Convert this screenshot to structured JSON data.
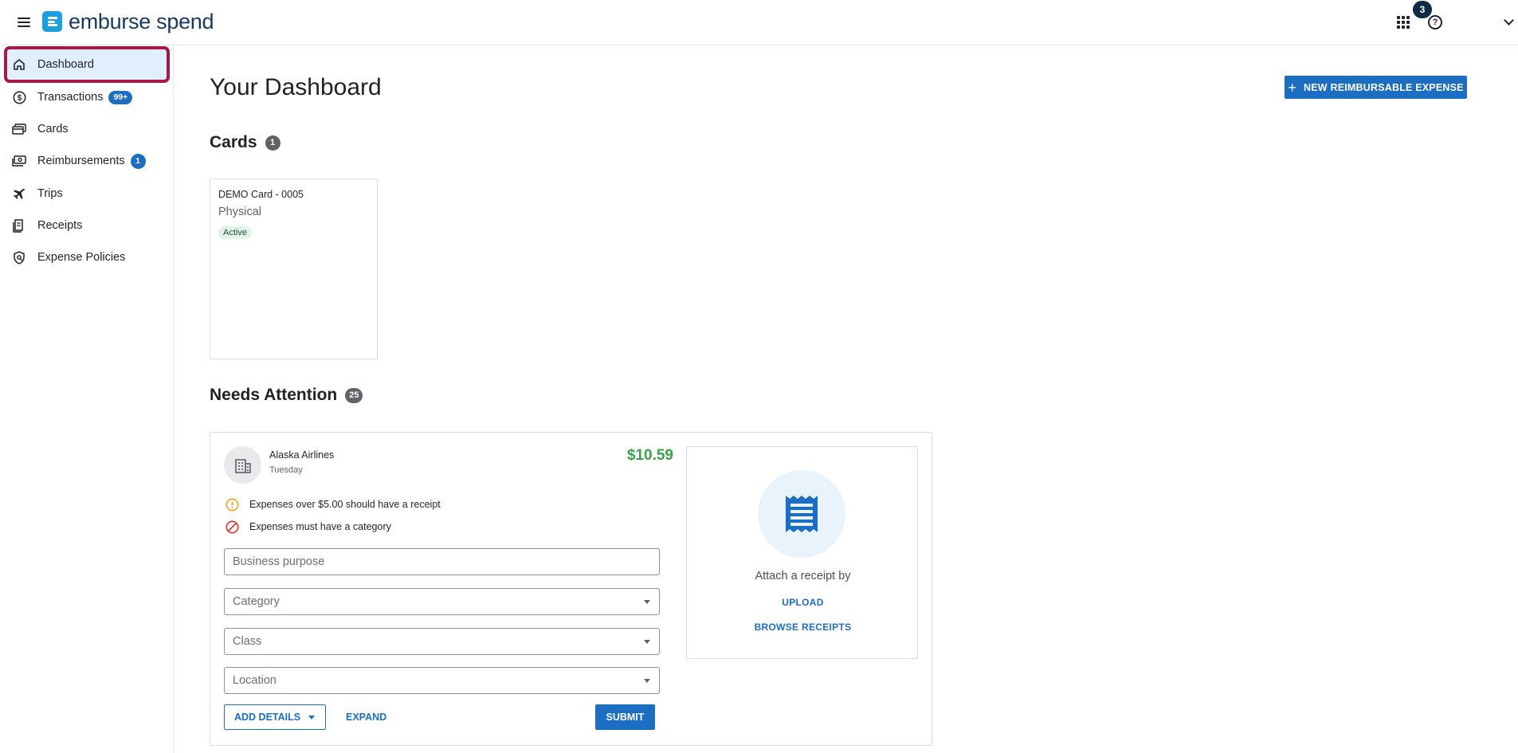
{
  "header": {
    "brand": "emburse spend",
    "notification_count": "3",
    "help_glyph": "?"
  },
  "sidebar": {
    "items": [
      {
        "label": "Dashboard",
        "icon": "home-icon",
        "active": true
      },
      {
        "label": "Transactions",
        "icon": "dollar-circle-icon",
        "badge": "99+"
      },
      {
        "label": "Cards",
        "icon": "cards-icon"
      },
      {
        "label": "Reimbursements",
        "icon": "cash-icon",
        "badge": "1"
      },
      {
        "label": "Trips",
        "icon": "airplane-icon"
      },
      {
        "label": "Receipts",
        "icon": "receipt-icon"
      },
      {
        "label": "Expense Policies",
        "icon": "shield-icon"
      }
    ]
  },
  "main": {
    "title": "Your Dashboard",
    "new_expense_button": "NEW REIMBURSABLE EXPENSE",
    "cards_section": {
      "title": "Cards",
      "count": "1",
      "cards": [
        {
          "name": "DEMO Card - 0005",
          "type": "Physical",
          "status": "Active"
        }
      ]
    },
    "attention_section": {
      "title": "Needs Attention",
      "count": "25",
      "item": {
        "merchant": "Alaska Airlines",
        "date": "Tuesday",
        "amount": "$10.59",
        "warnings": [
          {
            "text": "Expenses over $5.00 should have a receipt",
            "icon": "warning-circle-icon",
            "color": "#f0a020"
          },
          {
            "text": "Expenses must have a category",
            "icon": "prohibited-icon",
            "color": "#e0322e"
          }
        ],
        "fields": {
          "business_purpose": "Business purpose",
          "category": "Category",
          "class": "Class",
          "location": "Location"
        },
        "add_details": "ADD DETAILS",
        "expand": "EXPAND",
        "submit": "SUBMIT",
        "receipt": {
          "caption": "Attach a receipt by",
          "upload": "UPLOAD",
          "browse": "BROWSE RECEIPTS"
        }
      }
    }
  },
  "colors": {
    "primary": "#1b6ec2",
    "amount_green": "#3aa14b",
    "active_highlight": "#a31a4a"
  }
}
